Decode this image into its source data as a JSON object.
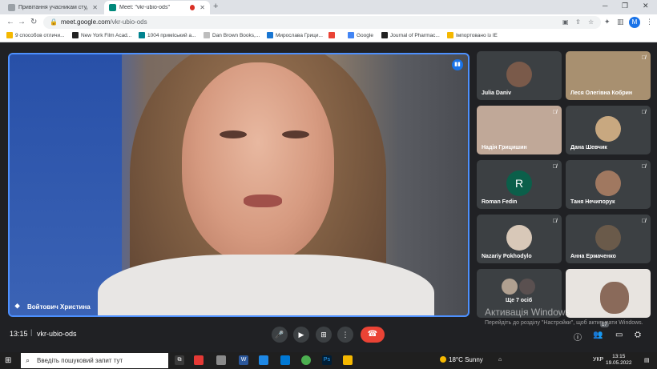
{
  "browser": {
    "tabs": [
      {
        "title": "Привітання учасникам студент",
        "fav_color": "#9aa0a6",
        "active": false
      },
      {
        "title": "Meet: \"vkr-ubio-ods\"",
        "fav_color": "#00897b",
        "active": true,
        "recording": true
      }
    ],
    "new_tab": "+",
    "url_host": "meet.google.com",
    "url_path": "/vkr-ubio-ods",
    "profile_initial": "M",
    "bookmarks": [
      {
        "label": "9 способов отличи...",
        "color": "#f5b800"
      },
      {
        "label": "New York Film Acad...",
        "color": "#222222"
      },
      {
        "label": "1004 приміський а...",
        "color": "#00838f"
      },
      {
        "label": "Dan Brown Books,...",
        "color": "#e0e0e0"
      },
      {
        "label": "Мирослава Грици...",
        "color": "#1976d2"
      },
      {
        "label": "",
        "color": "#ea4335"
      },
      {
        "label": "Google",
        "color": "#4285f4"
      },
      {
        "label": "Journal of Pharmac...",
        "color": "#222222"
      },
      {
        "label": "Імпортовано із IE",
        "color": "#f5b800"
      }
    ]
  },
  "meet": {
    "main_speaker": "Войтович Христина",
    "tiles": [
      {
        "name": "Julia Daniv",
        "kind": "avatar",
        "muted": false
      },
      {
        "name": "Леся Олегівна Кобрин",
        "kind": "video",
        "muted": true
      },
      {
        "name": "Надія Грицишин",
        "kind": "video",
        "muted": true
      },
      {
        "name": "Дана Шевчик",
        "kind": "avatar",
        "muted": true
      },
      {
        "name": "Roman Fedin",
        "kind": "letter",
        "letter": "R",
        "muted": true
      },
      {
        "name": "Таня Нечипорук",
        "kind": "avatar",
        "muted": true
      },
      {
        "name": "Nazariy Pokhodylo",
        "kind": "avatar",
        "muted": true
      },
      {
        "name": "Анна Ермаченко",
        "kind": "avatar",
        "muted": true
      },
      {
        "name": "Ще 7 осіб",
        "kind": "group",
        "muted": false
      },
      {
        "name": "",
        "kind": "video",
        "muted": false
      }
    ],
    "time": "13:15",
    "separator": "|",
    "meeting_code": "vkr-ubio-ods",
    "participants_count": "17"
  },
  "watermark": {
    "title": "Активація Windows",
    "text": "Перейдіть до розділу \"Настройки\", щоб активувати Windows."
  },
  "taskbar": {
    "search_placeholder": "Введіть пошуковий запит тут",
    "weather": "18°C  Sunny",
    "lang": "УКР",
    "time": "13:15",
    "date": "19.05.2022"
  }
}
